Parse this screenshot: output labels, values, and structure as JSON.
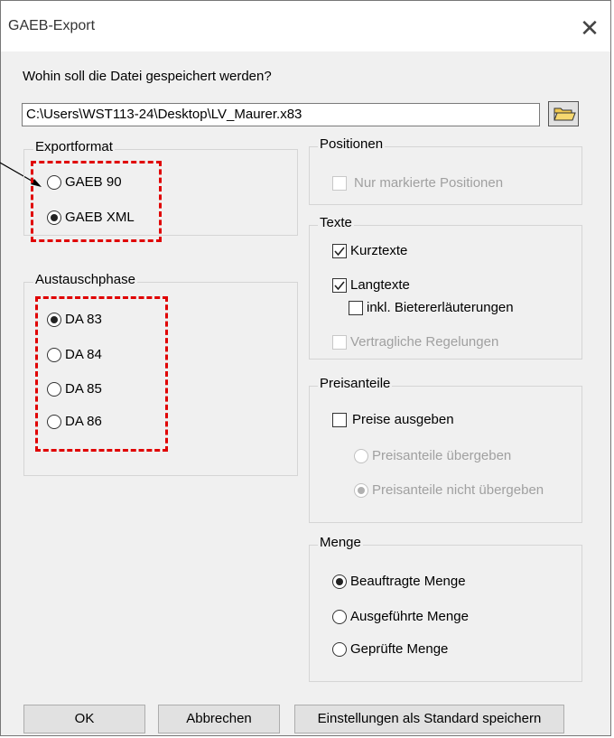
{
  "window": {
    "title": "GAEB-Export",
    "close_symbol": "✕"
  },
  "save": {
    "prompt": "Wohin soll die Datei gespeichert werden?",
    "path": "C:\\Users\\WST113-24\\Desktop\\LV_Maurer.x83"
  },
  "exportformat": {
    "label": "Exportformat",
    "options": [
      {
        "label": "GAEB 90",
        "selected": false
      },
      {
        "label": "GAEB XML",
        "selected": true
      }
    ]
  },
  "austauschphase": {
    "label": "Austauschphase",
    "options": [
      {
        "label": "DA 83",
        "selected": true
      },
      {
        "label": "DA 84",
        "selected": false
      },
      {
        "label": "DA 85",
        "selected": false
      },
      {
        "label": "DA 86",
        "selected": false
      }
    ]
  },
  "positionen": {
    "label": "Positionen",
    "nur_markierte": {
      "label": "Nur markierte Positionen",
      "checked": false,
      "enabled": false
    }
  },
  "texte": {
    "label": "Texte",
    "kurztexte": {
      "label": "Kurztexte",
      "checked": true
    },
    "langtexte": {
      "label": "Langtexte",
      "checked": true
    },
    "bietererlaeuterungen": {
      "label": "inkl. Bietererläuterungen",
      "checked": false
    },
    "vertragliche": {
      "label": "Vertragliche Regelungen",
      "checked": false,
      "enabled": false
    }
  },
  "preisanteile": {
    "label": "Preisanteile",
    "preise_ausgeben": {
      "label": "Preise ausgeben",
      "checked": false
    },
    "uebergeben": {
      "label": "Preisanteile übergeben",
      "selected": false,
      "enabled": false
    },
    "nicht_uebergeben": {
      "label": "Preisanteile nicht übergeben",
      "selected": true,
      "enabled": false
    }
  },
  "menge": {
    "label": "Menge",
    "options": [
      {
        "label": "Beauftragte Menge",
        "selected": true
      },
      {
        "label": "Ausgeführte Menge",
        "selected": false
      },
      {
        "label": "Geprüfte Menge",
        "selected": false
      }
    ]
  },
  "buttons": {
    "ok": "OK",
    "abbrechen": "Abbrechen",
    "standard": "Einstellungen als Standard speichern"
  },
  "colors": {
    "annotation_red": "#e00000",
    "dialog_bg": "#f0f0f0",
    "disabled_text": "#a0a0a0"
  }
}
